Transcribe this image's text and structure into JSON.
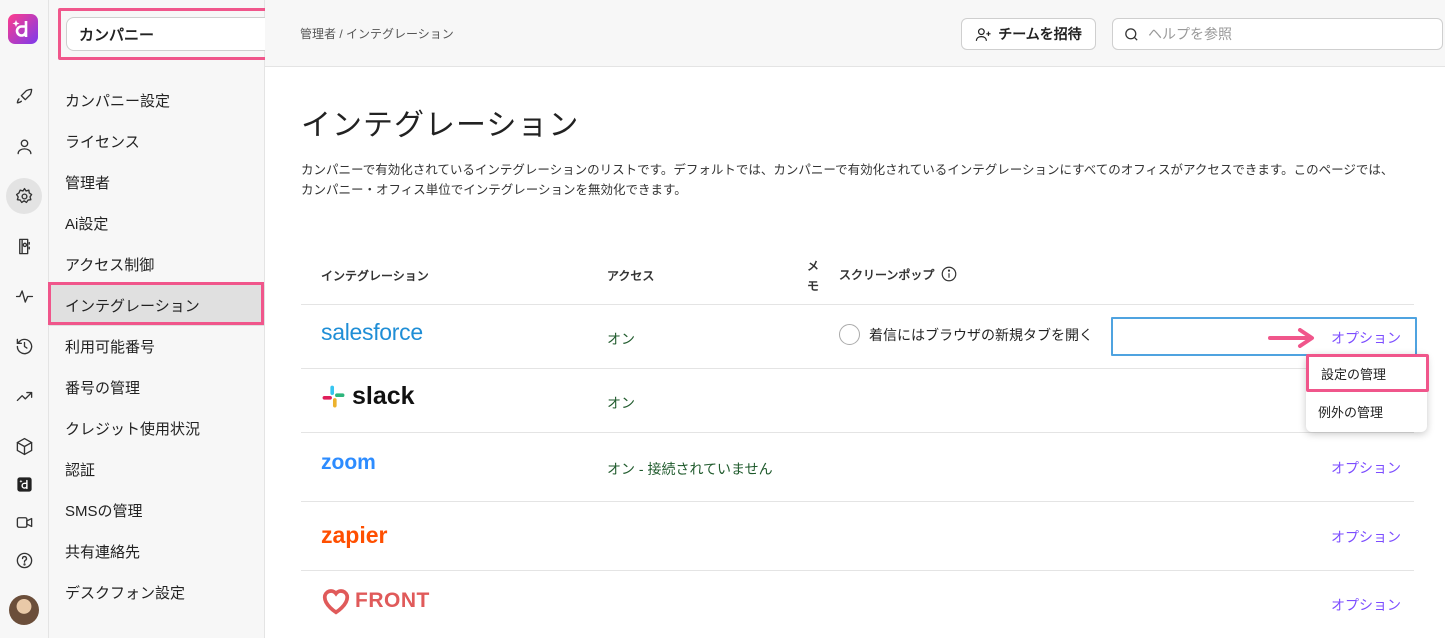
{
  "app": {
    "logo_icon": "dialpad-logo-icon",
    "brand_colors": {
      "accent": "#7c4dff",
      "highlight": "#f0568b",
      "access_on": "#1f5a2c"
    }
  },
  "rail": {
    "icons": [
      "rocket-icon",
      "person-icon",
      "gear-icon",
      "contacts-book-icon",
      "activity-icon",
      "history-icon",
      "trend-up-icon",
      "cube-icon",
      "dialpad-app-icon",
      "video-icon",
      "help-icon"
    ],
    "active": "gear-icon"
  },
  "sidebar": {
    "company_select": {
      "value": "カンパニー"
    },
    "items": [
      {
        "label": "カンパニー設定"
      },
      {
        "label": "ライセンス"
      },
      {
        "label": "管理者"
      },
      {
        "label": "Ai設定"
      },
      {
        "label": "アクセス制御"
      },
      {
        "label": "インテグレーション"
      },
      {
        "label": "利用可能番号"
      },
      {
        "label": "番号の管理"
      },
      {
        "label": "クレジット使用状況"
      },
      {
        "label": "認証"
      },
      {
        "label": "SMSの管理"
      },
      {
        "label": "共有連絡先"
      },
      {
        "label": "デスクフォン設定"
      }
    ],
    "active_index": 5
  },
  "topbar": {
    "breadcrumb": "管理者 / インテグレーション",
    "invite_label": "チームを招待",
    "search_placeholder": "ヘルプを参照"
  },
  "main": {
    "title": "インテグレーション",
    "description": "カンパニーで有効化されているインテグレーションのリストです。デフォルトでは、カンパニーで有効化されているインテグレーションにすべてのオフィスがアクセスできます。このページでは、カンパニー・オフィス単位でインテグレーションを無効化できます。",
    "table": {
      "headers": {
        "integration": "インテグレーション",
        "access": "アクセス",
        "memo": "メモ",
        "screenpop": "スクリーンポップ"
      },
      "rows": [
        {
          "name": "salesforce",
          "access": "オン",
          "screenpop": "着信にはブラウザの新規タブを開く",
          "options": "オプション"
        },
        {
          "name": "slack",
          "access": "オン",
          "options": ""
        },
        {
          "name": "zoom",
          "access": "オン - 接続されていません",
          "options": "オプション"
        },
        {
          "name": "zapier",
          "access": "",
          "options": "オプション"
        },
        {
          "name": "FRONT",
          "access": "",
          "options": "オプション"
        }
      ]
    },
    "options_menu": {
      "items": [
        "設定の管理",
        "例外の管理"
      ]
    }
  }
}
